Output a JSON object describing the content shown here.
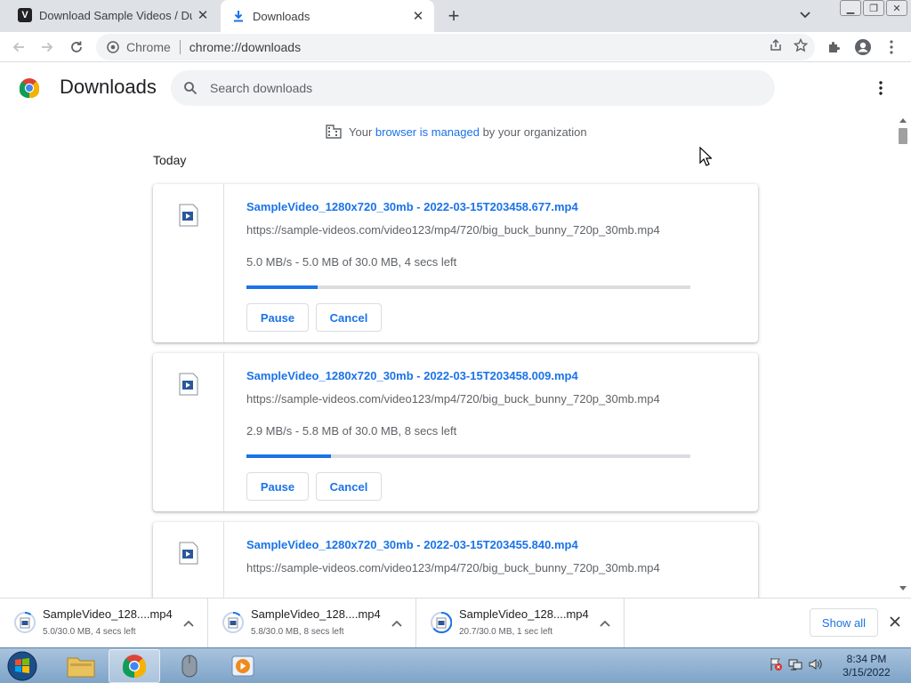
{
  "tabs": [
    {
      "title": "Download Sample Videos / Dum",
      "favicon": "V"
    },
    {
      "title": "Downloads"
    }
  ],
  "toolbar": {
    "site_label": "Chrome",
    "url": "chrome://downloads"
  },
  "page": {
    "title": "Downloads",
    "search_placeholder": "Search downloads",
    "managed_prefix": "Your ",
    "managed_link": "browser is managed",
    "managed_suffix": " by your organization",
    "section": "Today"
  },
  "downloads": [
    {
      "filename": "SampleVideo_1280x720_30mb - 2022-03-15T203458.677.mp4",
      "url": "https://sample-videos.com/video123/mp4/720/big_buck_bunny_720p_30mb.mp4",
      "status": "5.0 MB/s - 5.0 MB of 30.0 MB, 4 secs left",
      "progress": 0.16,
      "pause_label": "Pause",
      "cancel_label": "Cancel"
    },
    {
      "filename": "SampleVideo_1280x720_30mb - 2022-03-15T203458.009.mp4",
      "url": "https://sample-videos.com/video123/mp4/720/big_buck_bunny_720p_30mb.mp4",
      "status": "2.9 MB/s - 5.8 MB of 30.0 MB, 8 secs left",
      "progress": 0.19,
      "pause_label": "Pause",
      "cancel_label": "Cancel"
    },
    {
      "filename": "SampleVideo_1280x720_30mb - 2022-03-15T203455.840.mp4",
      "url": "https://sample-videos.com/video123/mp4/720/big_buck_bunny_720p_30mb.mp4"
    }
  ],
  "shelf": {
    "items": [
      {
        "name": "SampleVideo_128....mp4",
        "status": "5.0/30.0 MB, 4 secs left"
      },
      {
        "name": "SampleVideo_128....mp4",
        "status": "5.8/30.0 MB, 8 secs left"
      },
      {
        "name": "SampleVideo_128....mp4",
        "status": "20.7/30.0 MB, 1 sec left"
      }
    ],
    "show_all_label": "Show all"
  },
  "taskbar": {
    "time": "8:34 PM",
    "date": "3/15/2022"
  },
  "colors": {
    "accent": "#1a73e8",
    "tabstrip": "#dee1e6"
  }
}
